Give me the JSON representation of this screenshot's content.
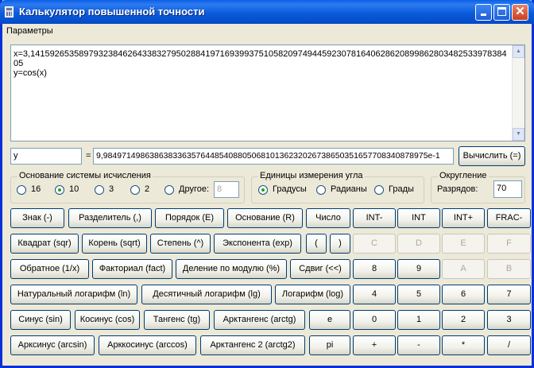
{
  "window": {
    "title": "Калькулятор повышенной точности",
    "controls": {
      "minimize": "minimize-icon",
      "maximize": "maximize-icon",
      "close": "close-icon",
      "close_glyph": "✕"
    }
  },
  "menu": {
    "params": "Параметры"
  },
  "output": {
    "text": "x=3,1415926535897932384626433832795028841971693993751058209749445923078164062862089986280348253397838405\ny=cos(x)",
    "scroll_up_glyph": "▲",
    "scroll_down_glyph": "▼"
  },
  "expression": {
    "var": "y",
    "equals": "=",
    "result": "9,984971498638638336357644854088050681013623202673865035165770834087897​5e-1",
    "compute_label": "Вычислить (=)"
  },
  "base_group": {
    "legend": "Основание системы исчисления",
    "options": [
      {
        "label": "16",
        "selected": false
      },
      {
        "label": "10",
        "selected": true
      },
      {
        "label": "3",
        "selected": false
      },
      {
        "label": "2",
        "selected": false
      },
      {
        "label": "Другое:",
        "selected": false
      }
    ],
    "other_value": "8"
  },
  "angle_group": {
    "legend": "Единицы измерения угла",
    "options": [
      {
        "label": "Градусы",
        "selected": true
      },
      {
        "label": "Радианы",
        "selected": false
      },
      {
        "label": "Грады",
        "selected": false
      }
    ]
  },
  "rounding_group": {
    "legend": "Округление",
    "digits_label": "Разрядов:",
    "digits_value": "70"
  },
  "buttons": {
    "sign": "Знак (-)",
    "separator": "Разделитель (,)",
    "order": "Порядок (E)",
    "base": "Основание (R)",
    "number": "Число",
    "int_minus": "INT-",
    "int": "INT",
    "int_plus": "INT+",
    "frac_minus": "FRAC-",
    "square": "Квадрат (sqr)",
    "root": "Корень (sqrt)",
    "power": "Степень (^)",
    "exponent": "Экспонента (exp)",
    "lparen": "(",
    "rparen": ")",
    "hex_c": "C",
    "hex_d": "D",
    "hex_e": "E",
    "hex_f": "F",
    "inverse": "Обратное (1/x)",
    "factorial": "Факториал (fact)",
    "mod": "Деление по модулю (%)",
    "shift": "Сдвиг (<<)",
    "d8": "8",
    "d9": "9",
    "hex_a": "A",
    "hex_b": "B",
    "ln": "Натуральный логарифм (ln)",
    "lg": "Десятичный логарифм (lg)",
    "log": "Логарифм (log)",
    "d4": "4",
    "d5": "5",
    "d6": "6",
    "d7": "7",
    "sin": "Синус (sin)",
    "cos": "Косинус (cos)",
    "tan": "Тангенс (tg)",
    "arctan": "Арктангенс (arctg)",
    "e": "e",
    "d0": "0",
    "d1": "1",
    "d2": "2",
    "d3": "3",
    "arcsin": "Арксинус (arcsin)",
    "arccos": "Арккосинус (arccos)",
    "arctan2": "Арктангенс 2 (arctg2)",
    "pi": "pi",
    "plus": "+",
    "minus": "-",
    "mul": "*",
    "div": "/"
  }
}
